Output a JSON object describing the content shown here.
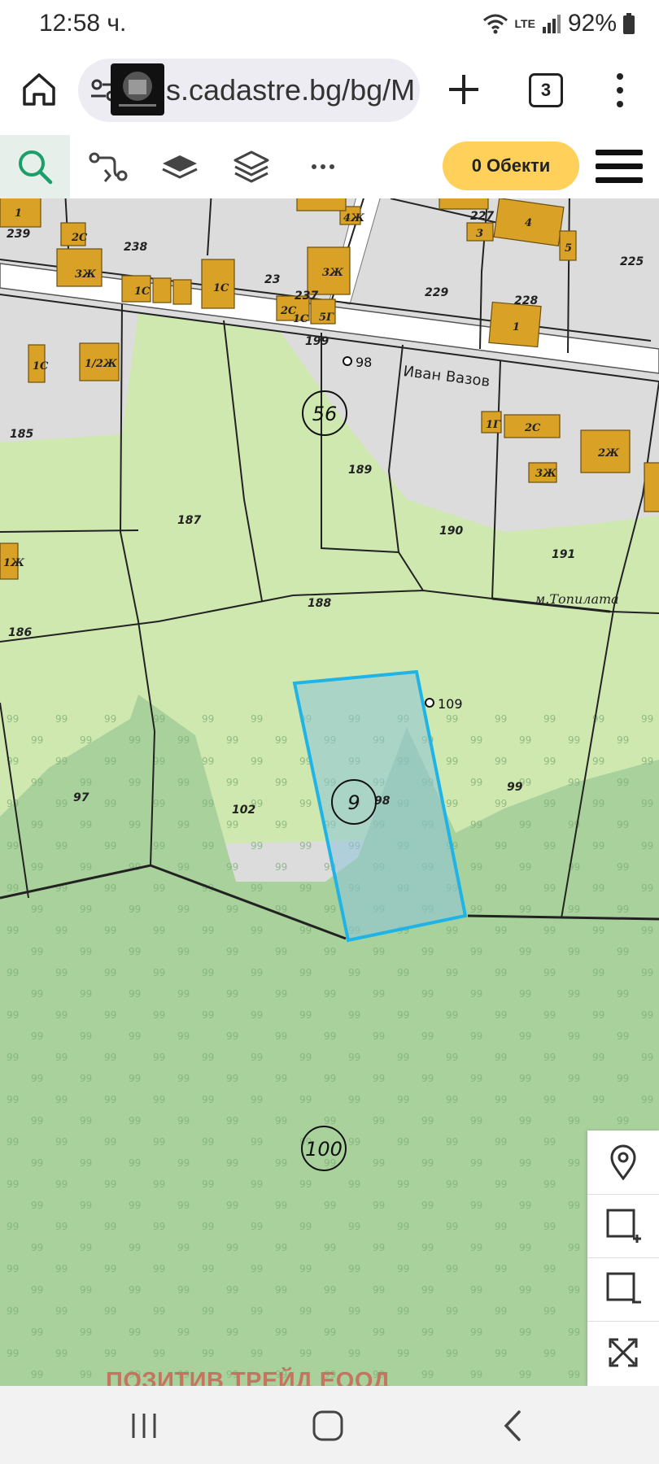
{
  "status_bar": {
    "time": "12:58 ч.",
    "battery": "92%",
    "network": "LTE"
  },
  "browser": {
    "url": "s.cadastre.bg/bg/M",
    "tab_count": "3"
  },
  "toolbar": {
    "objects_label": "0 Обекти"
  },
  "map": {
    "street_name": "Иван Вазов",
    "locality": "м.Топилата",
    "parcels": [
      "239",
      "238",
      "23",
      "237",
      "199",
      "229",
      "228",
      "227",
      "225",
      "185",
      "187",
      "189",
      "188",
      "190",
      "191",
      "186",
      "97",
      "102",
      "98",
      "99"
    ],
    "circled_labels": [
      "56",
      "9",
      "100"
    ],
    "point_labels": [
      "98",
      "109"
    ],
    "building_labels": [
      "1",
      "2С",
      "3Ж",
      "1С",
      "1С",
      "4Ж",
      "3Ж",
      "2С",
      "1С",
      "5Г",
      "3",
      "4",
      "5",
      "1",
      "1С",
      "1/2Ж",
      "1Г",
      "2С",
      "2Ж",
      "3Ж",
      "1Ж"
    ],
    "selection_color": "#1fb3e6"
  },
  "watermark": "ПОЗИТИВ ТРЕЙД ЕООД"
}
